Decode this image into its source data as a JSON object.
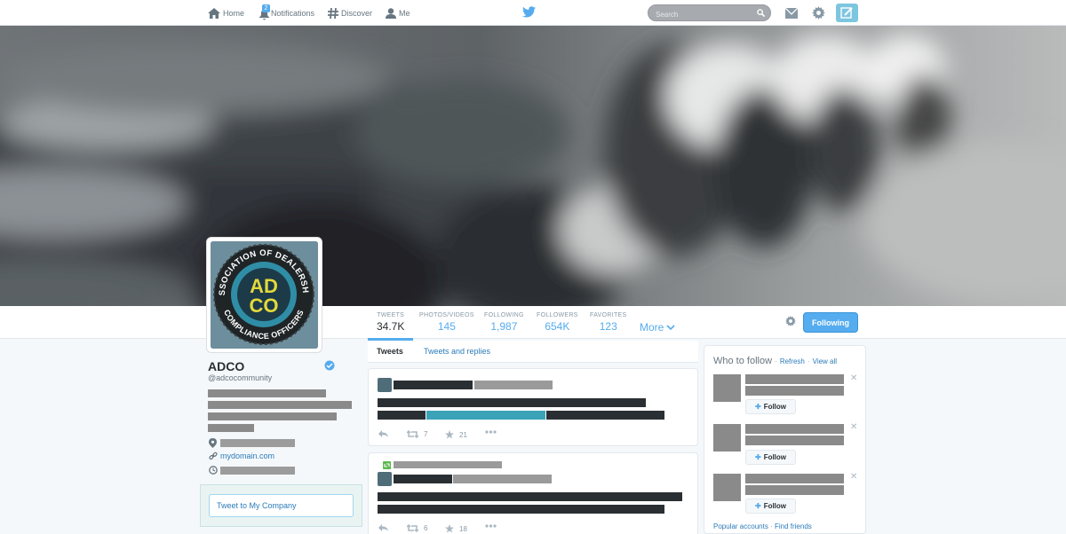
{
  "nav": {
    "home": "Home",
    "notifications": "Notifications",
    "notifications_count": "2",
    "discover": "Discover",
    "me": "Me",
    "search_placeholder": "Search"
  },
  "profile": {
    "name": "ADCO",
    "handle": "@adcocommunity",
    "website": "mydomain.com",
    "avatar_ring_text": "ASSOCIATION OF DEALERSHIP COMPLIANCE OFFICERS",
    "avatar_letters_top": "AD",
    "avatar_letters_bottom": "CO"
  },
  "stats": [
    {
      "label": "TWEETS",
      "value": "34.7K"
    },
    {
      "label": "PHOTOS/VIDEOS",
      "value": "145"
    },
    {
      "label": "FOLLOWING",
      "value": "1,987"
    },
    {
      "label": "FOLLOWERS",
      "value": "654K"
    },
    {
      "label": "FAVORITES",
      "value": "123"
    }
  ],
  "more_label": "More",
  "following_button": "Following",
  "tabs": {
    "tweets": "Tweets",
    "tweets_replies": "Tweets and replies"
  },
  "tweets": [
    {
      "retweets": "7",
      "favorites": "21"
    },
    {
      "retweets": "6",
      "favorites": "18"
    }
  ],
  "tweet_to": "Tweet to My Company",
  "who_to_follow": {
    "title": "Who to follow",
    "refresh": "Refresh",
    "view_all": "View all",
    "follow_label": "Follow",
    "popular": "Popular accounts",
    "find_friends": "Find friends",
    "separator": "·"
  },
  "colors": {
    "accent": "#55acee",
    "link": "#2b7bb9",
    "teal": "#3aa3b8"
  }
}
